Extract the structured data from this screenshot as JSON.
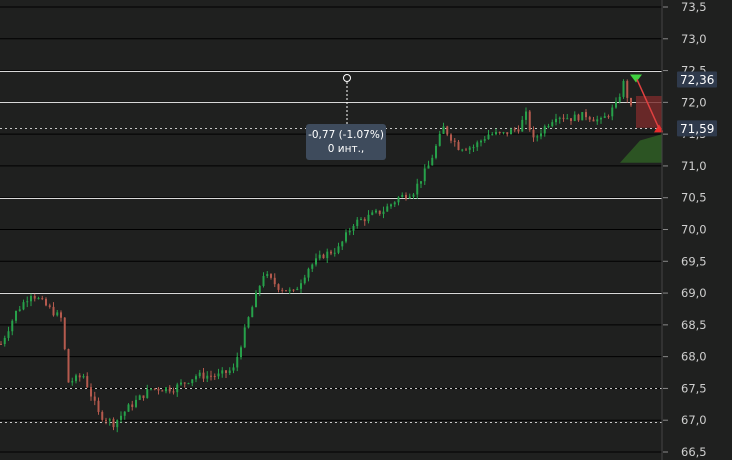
{
  "chart_data": {
    "type": "candlestick",
    "ylim": [
      66.5,
      73.5
    ],
    "y_ticks": [
      "73,5",
      "73,0",
      "72,5",
      "72,0",
      "71,5",
      "71,0",
      "70,5",
      "70,0",
      "69,5",
      "69,0",
      "68,5",
      "68,0",
      "67,5",
      "67,0",
      "66,5"
    ],
    "y_tick_values": [
      73.5,
      73.0,
      72.5,
      72.0,
      71.5,
      71.0,
      70.5,
      70.0,
      69.5,
      69.0,
      68.5,
      68.0,
      67.5,
      67.0,
      66.5
    ],
    "grid": true,
    "price_labels": [
      {
        "text": "72,36",
        "value": 72.36
      },
      {
        "text": "71,59",
        "value": 71.59
      }
    ],
    "horizontal_levels": [
      {
        "value": 72.5,
        "style": "solid"
      },
      {
        "value": 72.0,
        "style": "solid"
      },
      {
        "value": 71.59,
        "style": "dotted"
      },
      {
        "value": 70.5,
        "style": "solid"
      },
      {
        "value": 69.0,
        "style": "solid"
      },
      {
        "value": 67.5,
        "style": "dotted"
      },
      {
        "value": 66.97,
        "style": "dotted"
      }
    ],
    "anchors": [
      [
        0,
        68.2
      ],
      [
        4,
        68.7
      ],
      [
        8,
        69.0
      ],
      [
        12,
        68.8
      ],
      [
        16,
        68.6
      ],
      [
        18,
        67.6
      ],
      [
        22,
        67.7
      ],
      [
        26,
        67.1
      ],
      [
        30,
        66.95
      ],
      [
        34,
        67.2
      ],
      [
        40,
        67.5
      ],
      [
        46,
        67.5
      ],
      [
        52,
        67.7
      ],
      [
        58,
        67.7
      ],
      [
        62,
        67.8
      ],
      [
        66,
        68.6
      ],
      [
        70,
        69.3
      ],
      [
        74,
        69.1
      ],
      [
        78,
        69.0
      ],
      [
        82,
        69.4
      ],
      [
        86,
        69.6
      ],
      [
        90,
        69.7
      ],
      [
        94,
        70.1
      ],
      [
        98,
        70.2
      ],
      [
        102,
        70.3
      ],
      [
        106,
        70.5
      ],
      [
        110,
        70.6
      ],
      [
        114,
        71.0
      ],
      [
        118,
        71.6
      ],
      [
        122,
        71.3
      ],
      [
        126,
        71.3
      ],
      [
        130,
        71.5
      ],
      [
        134,
        71.5
      ],
      [
        138,
        71.6
      ],
      [
        140,
        71.8
      ],
      [
        142,
        71.4
      ],
      [
        144,
        71.55
      ],
      [
        148,
        71.8
      ],
      [
        152,
        71.75
      ],
      [
        156,
        71.8
      ],
      [
        160,
        71.7
      ],
      [
        164,
        71.95
      ],
      [
        166,
        72.3
      ],
      [
        168,
        71.9
      ]
    ],
    "annotation": {
      "change_text": "-0,77 (-1.07%)",
      "bars_text": "0 инт.,",
      "from_value": 72.36,
      "to_value": 71.59
    },
    "markers": [
      {
        "type": "triangle-down",
        "color": "#3fd13f",
        "value": 72.36
      },
      {
        "type": "triangle-up",
        "color": "#e82b2b",
        "value": 71.59
      }
    ]
  }
}
